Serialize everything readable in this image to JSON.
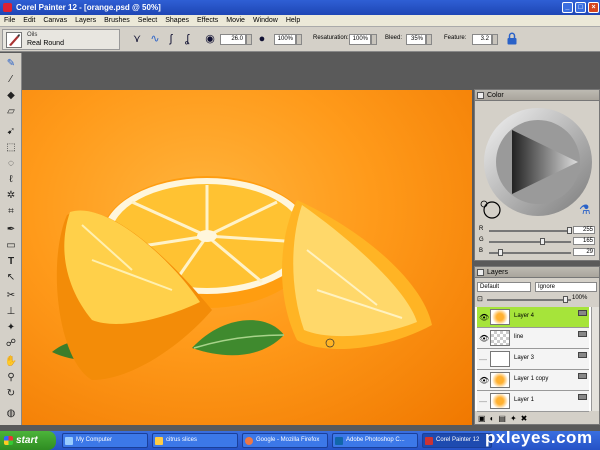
{
  "window": {
    "title": "Corel Painter 12 - [orange.psd @ 50%]",
    "controls": [
      "_",
      "□",
      "×"
    ]
  },
  "menu": [
    "File",
    "Edit",
    "Canvas",
    "Layers",
    "Brushes",
    "Select",
    "Shapes",
    "Effects",
    "Movie",
    "Window",
    "Help"
  ],
  "property_bar": {
    "brush_category": "Oils",
    "brush_variant": "Real Round",
    "size": "26.0",
    "opacity": "100%",
    "resaturation_label": "Resaturation:",
    "resaturation": "100%",
    "bleed_label": "Bleed:",
    "bleed": "35%",
    "feature_label": "Feature:",
    "feature": "3.2"
  },
  "color_panel": {
    "title": "Color",
    "channels": [
      {
        "name": "R",
        "value": "255",
        "fraction": 1.0
      },
      {
        "name": "G",
        "value": "165",
        "fraction": 0.65
      },
      {
        "name": "B",
        "value": "29",
        "fraction": 0.11
      }
    ]
  },
  "layers_panel": {
    "title": "Layers",
    "composite_method": "Default",
    "preserve": "Ignore",
    "opacity": "100%",
    "layers": [
      {
        "name": "Layer 4",
        "selected": true,
        "visible": true,
        "thumb": "orange"
      },
      {
        "name": "line",
        "selected": false,
        "visible": true,
        "thumb": "transparent"
      },
      {
        "name": "Layer 3",
        "selected": false,
        "visible": false,
        "thumb": "transparent"
      },
      {
        "name": "Layer 1 copy",
        "selected": false,
        "visible": true,
        "thumb": "orange"
      },
      {
        "name": "Layer 1",
        "selected": false,
        "visible": false,
        "thumb": "orange"
      }
    ]
  },
  "taskbar": {
    "start_label": "start",
    "tasks": [
      "My Computer",
      "citrus slices",
      "Google - Mozilla Firefox",
      "Adobe Photoshop C...",
      "Corel Painter 12"
    ]
  },
  "watermark": "pxleyes.com",
  "colors": {
    "title_bar": "#1e46b5",
    "selected_layer": "#a6e43a",
    "canvas_orange": "#ff9a1a"
  }
}
